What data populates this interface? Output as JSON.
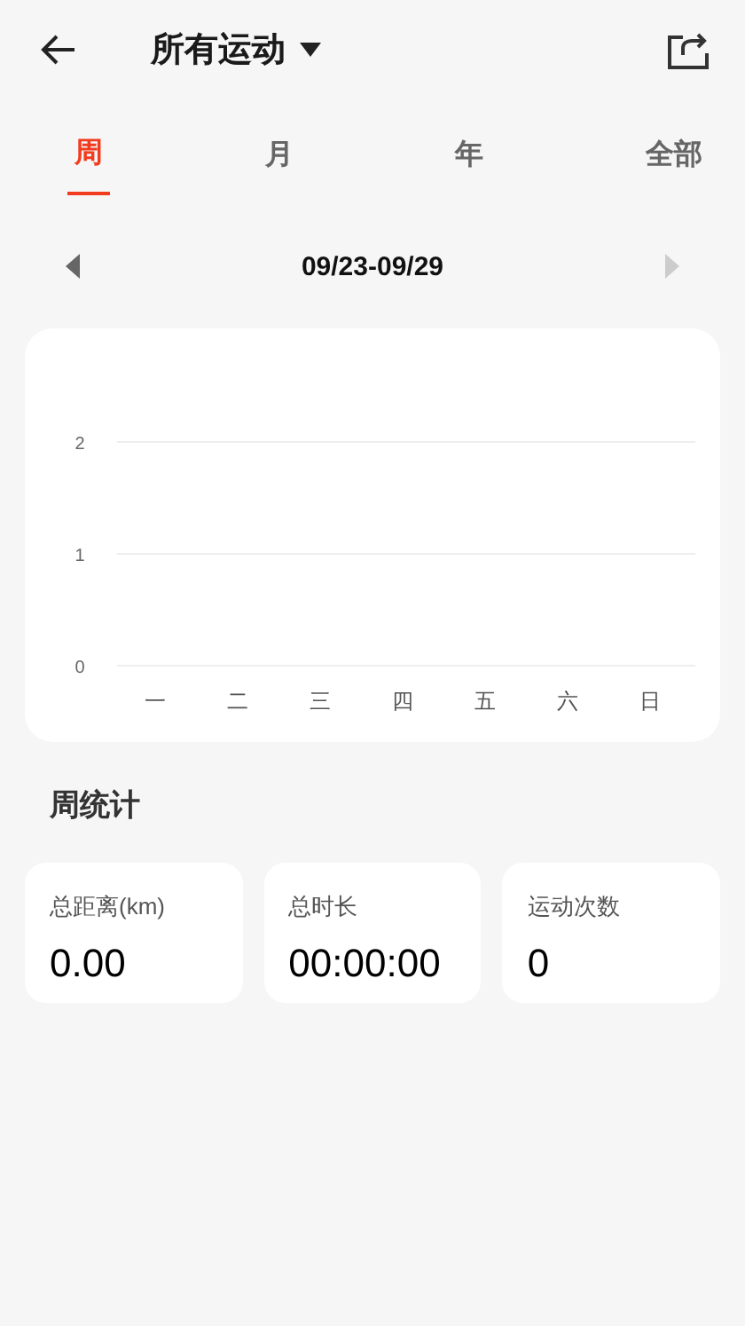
{
  "header": {
    "title": "所有运动"
  },
  "tabs": [
    {
      "label": "周",
      "selected": true
    },
    {
      "label": "月",
      "selected": false
    },
    {
      "label": "年",
      "selected": false
    },
    {
      "label": "全部",
      "selected": false
    }
  ],
  "date_nav": {
    "range": "09/23-09/29",
    "prev_disabled": false,
    "next_disabled": true
  },
  "chart": {
    "chart_data": {
      "type": "bar",
      "categories": [
        "一",
        "二",
        "三",
        "四",
        "五",
        "六",
        "日"
      ],
      "values": [
        0,
        0,
        0,
        0,
        0,
        0,
        0
      ],
      "ylim": [
        0,
        2
      ],
      "yticks": [
        0,
        1,
        2
      ]
    }
  },
  "summary": {
    "title": "周统计",
    "stats": [
      {
        "label": "总距离(km)",
        "value": "0.00"
      },
      {
        "label": "总时长",
        "value": "00:00:00"
      },
      {
        "label": "运动次数",
        "value": "0"
      }
    ]
  }
}
